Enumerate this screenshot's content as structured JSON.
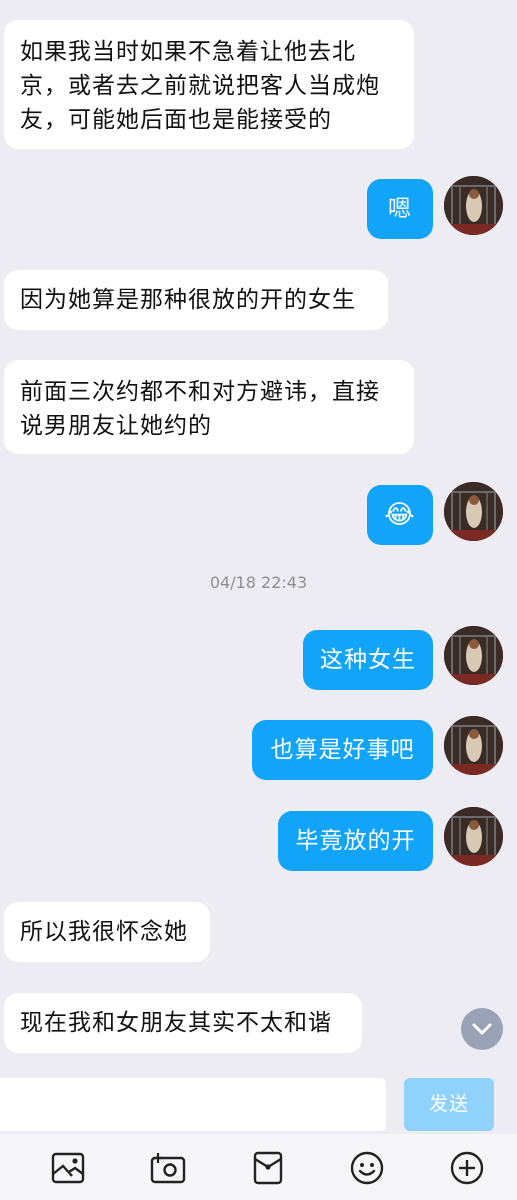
{
  "messages": [
    {
      "side": "in",
      "text": "如果我当时如果不急着让他去北京，或者去之前就说把客人当成炮友，可能她后面也是能接受的"
    },
    {
      "side": "out",
      "text": "嗯"
    },
    {
      "side": "in",
      "text": "因为她算是那种很放的开的女生"
    },
    {
      "side": "in",
      "text": "前面三次约都不和对方避讳，直接说男朋友让她约的"
    },
    {
      "side": "out",
      "text": "😂"
    },
    {
      "side": "out",
      "text": "这种女生"
    },
    {
      "side": "out",
      "text": "也算是好事吧"
    },
    {
      "side": "out",
      "text": "毕竟放的开"
    },
    {
      "side": "in",
      "text": "所以我很怀念她"
    },
    {
      "side": "in",
      "text": "现在我和女朋友其实不太和谐"
    }
  ],
  "timestamp": "04/18 22:43",
  "input": {
    "value": "",
    "send_label": "发送"
  },
  "toolbar": {
    "icons": [
      "image-icon",
      "camera-icon",
      "red-packet-icon",
      "emoji-icon",
      "plus-icon"
    ]
  },
  "colors": {
    "outgoing_bubble": "#12a4f8",
    "incoming_bubble": "#ffffff",
    "background": "#ececf2",
    "send_button": "#8fd2fb"
  }
}
